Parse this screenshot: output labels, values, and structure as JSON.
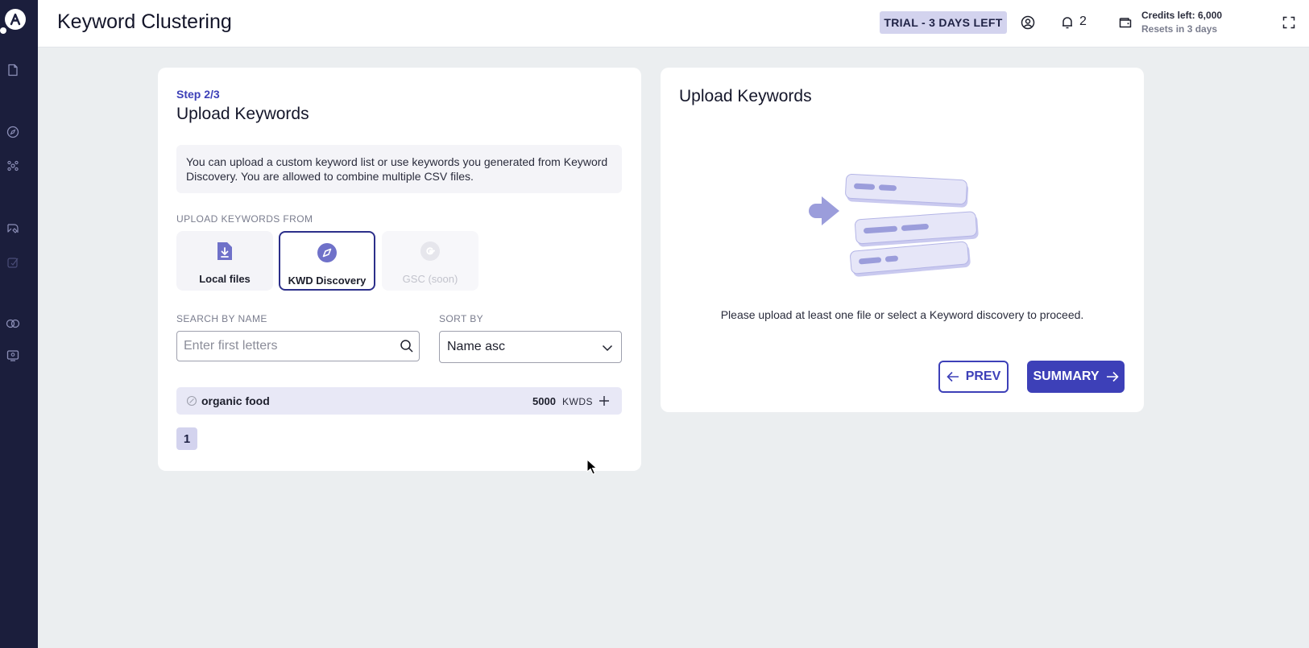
{
  "app": {
    "page_title": "Keyword Clustering",
    "trial_badge": "TRIAL - 3 DAYS LEFT",
    "notification_count": "2",
    "credits_title": "Credits left: 6,000",
    "credits_sub": "Resets in 3 days"
  },
  "sidebar": {
    "items": [
      {
        "icon": "document-icon"
      },
      {
        "icon": "compass-icon"
      },
      {
        "icon": "cluster-icon"
      },
      {
        "icon": "pen-tool-icon"
      },
      {
        "icon": "edit-check-icon"
      },
      {
        "icon": "link-icon"
      },
      {
        "icon": "monitor-icon"
      }
    ]
  },
  "left_card": {
    "step": "Step 2/3",
    "title": "Upload Keywords",
    "info": "You can upload a custom keyword list or use keywords you generated from Keyword Discovery. You are allowed to combine multiple CSV files.",
    "upload_from_label": "UPLOAD KEYWORDS FROM",
    "sources": [
      {
        "label": "Local files",
        "icon": "download-file-icon",
        "state": "default"
      },
      {
        "label": "KWD Discovery",
        "icon": "compass-icon",
        "state": "active"
      },
      {
        "label": "GSC (soon)",
        "icon": "google-icon",
        "state": "disabled"
      }
    ],
    "search_label": "SEARCH BY NAME",
    "search_placeholder": "Enter first letters",
    "sort_label": "SORT BY",
    "sort_value": "Name asc",
    "keywords": [
      {
        "name": "organic food",
        "count": "5000",
        "unit": "KWDS"
      }
    ],
    "page": "1"
  },
  "right_card": {
    "title": "Upload Keywords",
    "hint": "Please upload at least one file or select a Keyword discovery to proceed.",
    "prev_label": "PREV",
    "summary_label": "SUMMARY"
  },
  "colors": {
    "sidebar": "#1b1e3c",
    "accent": "#3d40b8",
    "badge": "#d3d3ee"
  }
}
